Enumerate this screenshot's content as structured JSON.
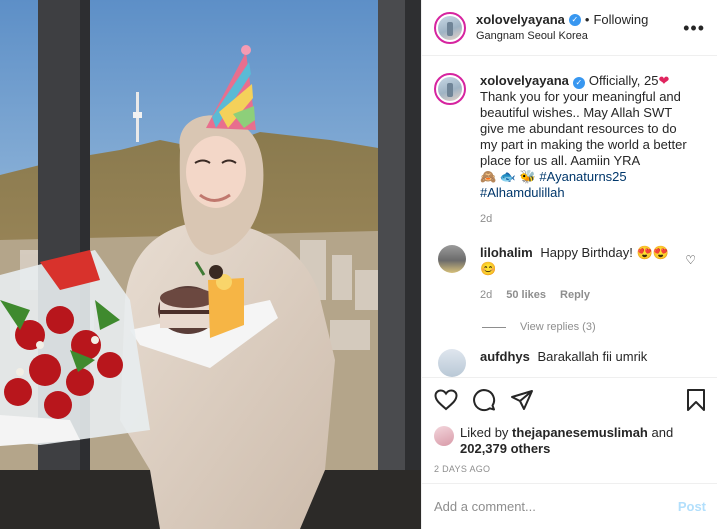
{
  "post": {
    "username": "xolovelyayana",
    "verified": true,
    "follow_state": "Following",
    "location": "Gangnam Seoul Korea"
  },
  "caption": {
    "username": "xolovelyayana",
    "lead": "Officially, 25",
    "heart": "❤",
    "body": "Thank you for your meaningful and beautiful wishes.. May Allah SWT give me abundant resources to do my part in making the world a better place for us all. Aamiin YRA",
    "emojis": "🙈 🐟 🐝",
    "hashtag1": "#Ayanaturns25",
    "hashtag2": "#Alhamdulillah",
    "age": "2d"
  },
  "comments": [
    {
      "username": "lilohalim",
      "text": "Happy Birthday!",
      "emojis": "😍😍 😊",
      "age": "2d",
      "likes": "50 likes",
      "reply_label": "Reply",
      "view_replies": "View replies (3)"
    },
    {
      "username": "aufdhys",
      "text": "Barakallah fii umrik"
    }
  ],
  "likes": {
    "prefix": "Liked by",
    "by_user": "thejapanesemuslimah",
    "and": "and",
    "others": "202,379 others"
  },
  "timestamp": "2 DAYS AGO",
  "add_comment": {
    "placeholder": "Add a comment...",
    "post_label": "Post"
  },
  "icons": {
    "like": "heart-outline-icon",
    "comment": "speech-bubble-icon",
    "share": "paper-plane-icon",
    "save": "bookmark-icon",
    "more": "ellipsis-icon"
  },
  "colors": {
    "verified": "#3897f0",
    "link": "#00376b",
    "muted": "#8e8e8e",
    "post_disabled": "#b2dffc",
    "story_ring": "#d6249f"
  }
}
